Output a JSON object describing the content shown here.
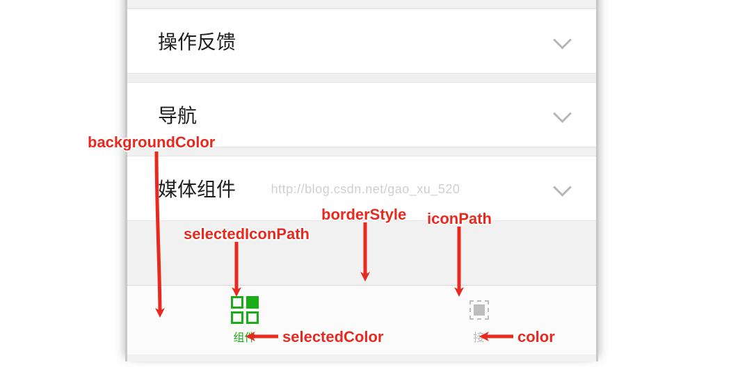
{
  "rows": {
    "r0": {
      "label": ""
    },
    "r1": {
      "label": "操作反馈"
    },
    "r2": {
      "label": "导航"
    },
    "r3": {
      "label": "媒体组件"
    }
  },
  "tabbar": {
    "selected": {
      "label": "组件"
    },
    "unselected": {
      "label": "接"
    }
  },
  "watermark": "http://blog.csdn.net/gao_xu_520",
  "annotations": {
    "backgroundColor": "backgroundColor",
    "selectedIconPath": "selectedIconPath",
    "borderStyle": "borderStyle",
    "iconPath": "iconPath",
    "selectedColor": "selectedColor",
    "color": "color"
  }
}
